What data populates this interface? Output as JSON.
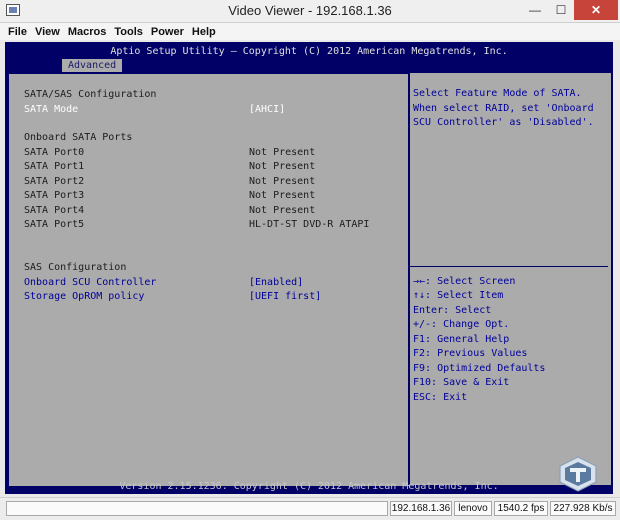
{
  "window": {
    "title": "Video Viewer - 192.168.1.36",
    "minimize_glyph": "—",
    "maximize_glyph": "☐",
    "close_glyph": "✕"
  },
  "menu": [
    "File",
    "View",
    "Macros",
    "Tools",
    "Power",
    "Help"
  ],
  "bios": {
    "header": "Aptio Setup Utility – Copyright (C) 2012 American Megatrends, Inc.",
    "active_tab": "Advanced",
    "section_sata": "SATA/SAS Configuration",
    "sata_mode": {
      "label": "SATA Mode",
      "value": "[AHCI]"
    },
    "ports_heading": "Onboard SATA Ports",
    "ports": [
      {
        "label": "SATA Port0",
        "value": "Not Present"
      },
      {
        "label": "SATA Port1",
        "value": "Not Present"
      },
      {
        "label": "SATA Port2",
        "value": "Not Present"
      },
      {
        "label": "SATA Port3",
        "value": "Not Present"
      },
      {
        "label": "SATA Port4",
        "value": "Not Present"
      },
      {
        "label": "SATA Port5",
        "value": "HL-DT-ST DVD-R ATAPI"
      }
    ],
    "sas_heading": "SAS Configuration",
    "scu": {
      "label": "Onboard SCU Controller",
      "value": "[Enabled]"
    },
    "oprom": {
      "label": "Storage OpROM policy",
      "value": "[UEFI first]"
    },
    "help_lines": [
      "Select Feature Mode of SATA.",
      "When select RAID, set 'Onboard",
      "SCU Controller' as 'Disabled'."
    ],
    "key_help": [
      "→←: Select Screen",
      "↑↓: Select Item",
      "Enter: Select",
      "+/-: Change Opt.",
      "F1: General Help",
      "F2: Previous Values",
      "F9: Optimized Defaults",
      "F10: Save & Exit",
      "ESC: Exit"
    ],
    "footer": "Version 2.15.1236. Copyright (C) 2012 American Megatrends, Inc."
  },
  "status": {
    "ip": "192.168.1.36",
    "user": "lenovo",
    "fps": "1540.2 fps",
    "rate": "227.928 Kb/s"
  },
  "colors": {
    "bios_background": "#000066",
    "bios_panel": "#ababab",
    "highlight_text": "#000099",
    "close_button": "#c7443b"
  }
}
